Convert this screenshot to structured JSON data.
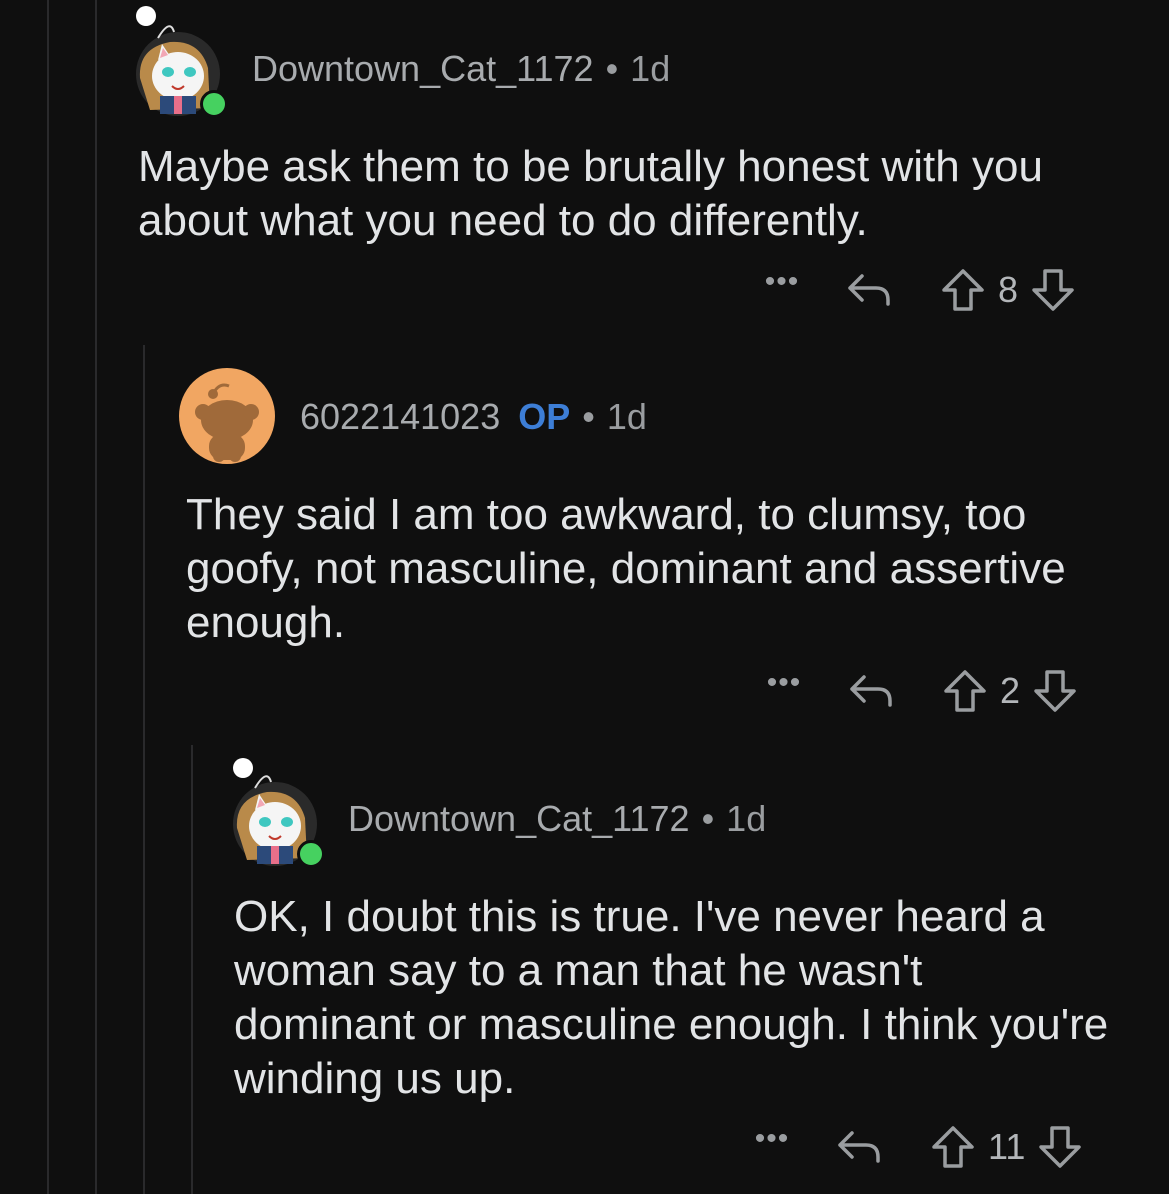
{
  "comments": [
    {
      "author": "Downtown_Cat_1172",
      "op_badge": "",
      "age": "1d",
      "body": "Maybe ask them to be brutally honest with you about what you need to do differently.",
      "score": "8",
      "more_label": "•••",
      "online": true,
      "avatar": "cat-snoo-avatar-icon"
    },
    {
      "author": "6022141023",
      "op_badge": "OP",
      "age": "1d",
      "body": "They said I am too awkward, to clumsy, too goofy, not masculine, dominant and assertive enough.",
      "score": "2",
      "more_label": "•••",
      "online": false,
      "avatar": "default-snoo-avatar-icon"
    },
    {
      "author": "Downtown_Cat_1172",
      "op_badge": "",
      "age": "1d",
      "body": "OK, I doubt this is true. I've never heard a woman say to a man that he wasn't dominant or masculine enough. I think you're winding us up.",
      "score": "11",
      "more_label": "•••",
      "online": true,
      "avatar": "cat-snoo-avatar-icon"
    }
  ],
  "separator": "•",
  "colors": {
    "background": "#0f0f0f",
    "op_badge": "#3d7ed6",
    "online": "#46d160",
    "thread_line": "#2a2a2c",
    "default_avatar_bg": "#f1a662"
  }
}
